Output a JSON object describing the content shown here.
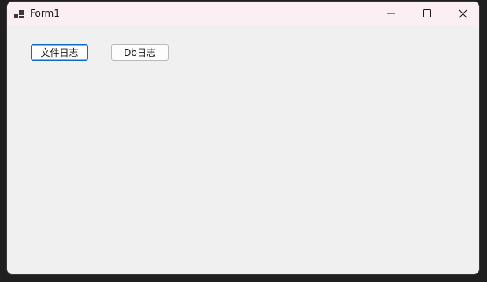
{
  "window": {
    "title": "Form1",
    "icon": "app-window-icon",
    "controls": {
      "minimize_icon": "minimize-icon",
      "maximize_icon": "maximize-icon",
      "close_icon": "close-icon"
    }
  },
  "buttons": {
    "file_log_label": "文件日志",
    "db_log_label": "Db日志"
  },
  "colors": {
    "titlebar_bg": "#fbeff3",
    "client_bg": "#f0f0f0",
    "focus_accent": "#0f6cbd"
  }
}
